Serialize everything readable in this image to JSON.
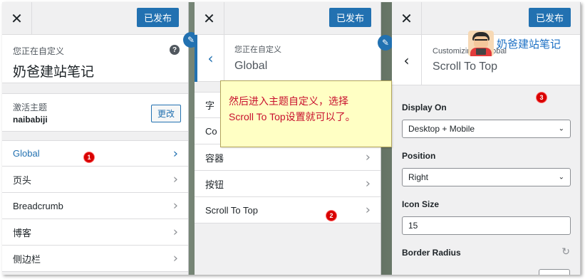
{
  "panel1": {
    "close_label": "✕",
    "publish_label": "已发布",
    "customizing_label": "您正在自定义",
    "site_title": "奶爸建站笔记",
    "help_label": "?",
    "active_theme_label": "激活主题",
    "theme_name": "naibabiji",
    "change_label": "更改",
    "items": [
      {
        "label": "Global"
      },
      {
        "label": "页头"
      },
      {
        "label": "Breadcrumb"
      },
      {
        "label": "博客"
      },
      {
        "label": "侧边栏"
      }
    ],
    "marker": "1"
  },
  "panel2": {
    "close_label": "✕",
    "publish_label": "已发布",
    "customizing_label": "您正在自定义",
    "section_title": "Global",
    "items": [
      {
        "label": "字"
      },
      {
        "label": "Co"
      },
      {
        "label": "容器"
      },
      {
        "label": "按钮"
      },
      {
        "label": "Scroll To Top"
      }
    ],
    "marker": "2"
  },
  "panel3": {
    "close_label": "✕",
    "publish_label": "已发布",
    "breadcrumb": "Customizing ▸ Global",
    "section_title": "Scroll To Top",
    "marker": "3",
    "fields": {
      "display_on_label": "Display On",
      "display_on_value": "Desktop + Mobile",
      "position_label": "Position",
      "position_value": "Right",
      "icon_size_label": "Icon Size",
      "icon_size_value": "15",
      "border_radius_label": "Border Radius"
    }
  },
  "annotation": {
    "text_line1": "然后进入主题自定义，选择",
    "text_line2": "Scroll To Top设置就可以了。"
  },
  "watermark": {
    "text": "奶爸建站笔记"
  },
  "colors": {
    "accent": "#2271b1",
    "marker": "#d80000",
    "annotation_text": "#c8102e",
    "annotation_bg": "#ffffc4"
  }
}
